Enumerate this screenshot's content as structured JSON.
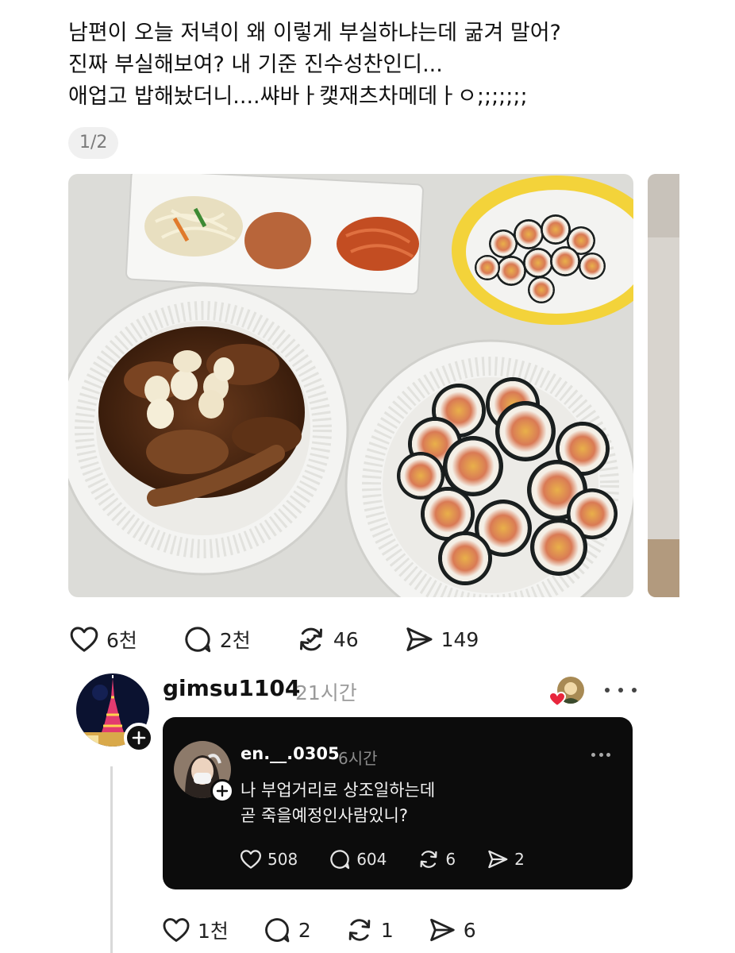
{
  "post": {
    "lines": [
      "남편이 오늘 저녁이 왜 이렇게 부실하냐는데 굶겨 말어?",
      "진짜 부실해보여? 내 기준 진수성찬인디...",
      "애업고 밥해놨더니....쌰바ㅏ캧재츠차메데ㅏㅇ;;;;;;;"
    ],
    "image_counter": "1/2",
    "actions": {
      "likes": "6천",
      "comments": "2천",
      "reposts": "46",
      "shares": "149"
    }
  },
  "reply": {
    "username": "gimsu1104",
    "time": "21시간",
    "quoted": {
      "username": "en.__.0305",
      "time": "6시간",
      "lines": [
        "나 부업거리로 상조일하는데",
        "곧 죽을예정인사람있니?"
      ],
      "actions": {
        "likes": "508",
        "comments": "604",
        "reposts": "6",
        "shares": "2"
      }
    },
    "actions": {
      "likes": "1천",
      "comments": "2",
      "reposts": "1",
      "shares": "6"
    }
  },
  "icons": {
    "like": "heart-icon",
    "comment": "comment-bubble-icon",
    "repost": "repost-icon",
    "share": "send-icon",
    "follow": "plus-icon",
    "more": "more-dots-icon"
  },
  "colors": {
    "heart_badge": "#e8263c",
    "quote_card_bg": "#0c0c0c",
    "muted_text": "#9a9a9a"
  }
}
